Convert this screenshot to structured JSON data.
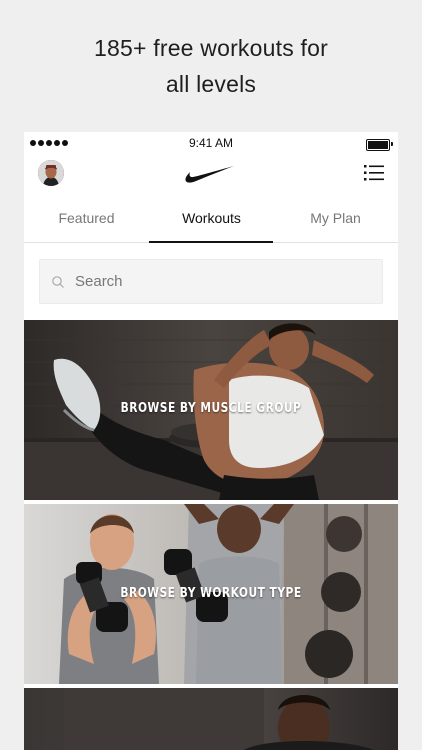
{
  "promo": {
    "headline_line1": "185+ free workouts for",
    "headline_line2": "all levels"
  },
  "status_bar": {
    "time": "9:41 AM"
  },
  "navbar": {
    "logo": "nike-swoosh",
    "menu_icon": "list-menu-icon"
  },
  "tabs": [
    {
      "label": "Featured",
      "active": false
    },
    {
      "label": "Workouts",
      "active": true
    },
    {
      "label": "My Plan",
      "active": false
    }
  ],
  "search": {
    "placeholder": "Search"
  },
  "cards": [
    {
      "label": "BROWSE BY MUSCLE GROUP"
    },
    {
      "label": "BROWSE BY WORKOUT TYPE"
    },
    {
      "label": ""
    }
  ],
  "colors": {
    "accent": "#111111",
    "background": "#efefef",
    "tab_inactive": "#777777"
  }
}
